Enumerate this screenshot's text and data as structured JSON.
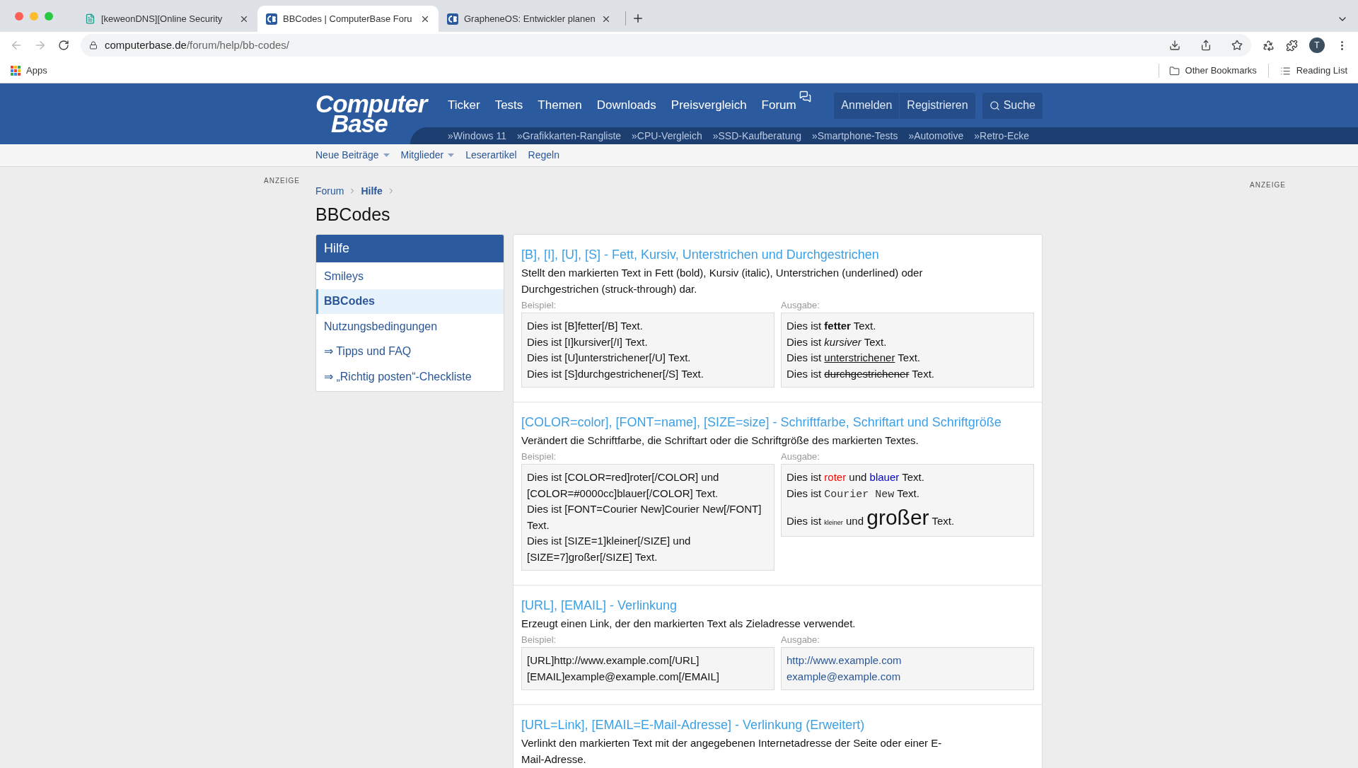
{
  "browser": {
    "tabs": [
      {
        "title": "[keweonDNS][Online Security",
        "selected": false,
        "kind": "document"
      },
      {
        "title": "BBCodes | ComputerBase Foru",
        "selected": true,
        "kind": "site"
      },
      {
        "title": "GrapheneOS: Entwickler planen",
        "selected": false,
        "kind": "site"
      }
    ],
    "address": {
      "host": "computerbase.de",
      "path": "/forum/help/bb-codes/"
    },
    "profile": "T",
    "bookmarks": [
      "Apps"
    ],
    "bookmarks_right": [
      "Other Bookmarks",
      "Reading List"
    ]
  },
  "header": {
    "logo": {
      "line1": "Computer",
      "line2": "Base"
    },
    "nav": [
      "Ticker",
      "Tests",
      "Themen",
      "Downloads",
      "Preisvergleich",
      "Forum"
    ],
    "account_buttons": [
      "Anmelden",
      "Registrieren"
    ],
    "search_button": "Suche",
    "quick_links": [
      "»Windows 11",
      "»Grafikkarten-Rangliste",
      "»CPU-Vergleich",
      "»SSD-Kaufberatung",
      "»Smartphone-Tests",
      "»Automotive",
      "»Retro-Ecke"
    ]
  },
  "subnav": [
    {
      "label": "Neue Beiträge",
      "dropdown": true
    },
    {
      "label": "Mitglieder",
      "dropdown": true
    },
    {
      "label": "Leserartikel",
      "dropdown": false
    },
    {
      "label": "Regeln",
      "dropdown": false
    }
  ],
  "ads": [
    "ANZEIGE",
    "ANZEIGE"
  ],
  "breadcrumb": [
    {
      "label": "Forum",
      "current": false
    },
    {
      "label": "Hilfe",
      "current": true
    }
  ],
  "page_title": "BBCodes",
  "sidebar": {
    "title": "Hilfe",
    "items": [
      {
        "label": "Smileys",
        "selected": false
      },
      {
        "label": "BBCodes",
        "selected": true
      },
      {
        "label": "Nutzungsbedingungen",
        "selected": false
      },
      {
        "label": "⇒ Tipps und FAQ",
        "selected": false
      },
      {
        "label": "⇒ „Richtig posten“-Checkliste",
        "selected": false
      }
    ]
  },
  "sections": [
    {
      "title": "[B], [I], [U], [S] - Fett, Kursiv, Unterstrichen und Durchgestrichen",
      "description": "Stellt den markierten Text in Fett (bold), Kursiv (italic), Unterstrichen (underlined) oder Durchgestrichen (struck-through) dar.",
      "example_label": "Beispiel:",
      "output_label": "Ausgabe:",
      "example_lines": [
        "Dies ist [B]fetter[/B] Text.",
        "Dies ist [I]kursiver[/I] Text.",
        "Dies ist [U]unterstrichener[/U] Text.",
        "Dies ist [S]durchgestrichener[/S] Text."
      ],
      "output_lines": [
        [
          {
            "text": "Dies ist "
          },
          {
            "text": "fetter",
            "kind": "bold"
          },
          {
            "text": " Text."
          }
        ],
        [
          {
            "text": "Dies ist "
          },
          {
            "text": "kursiver",
            "kind": "italic"
          },
          {
            "text": " Text."
          }
        ],
        [
          {
            "text": "Dies ist "
          },
          {
            "text": "unterstrichener",
            "kind": "underline"
          },
          {
            "text": " Text."
          }
        ],
        [
          {
            "text": "Dies ist "
          },
          {
            "text": "durchgestrichener",
            "kind": "strike"
          },
          {
            "text": " Text."
          }
        ]
      ]
    },
    {
      "title": "[COLOR=color], [FONT=name], [SIZE=size] - Schriftfarbe, Schriftart und Schriftgröße",
      "description": "Verändert die Schriftfarbe, die Schriftart oder die Schriftgröße des markierten Textes.",
      "example_label": "Beispiel:",
      "output_label": "Ausgabe:",
      "example_lines": [
        "Dies ist [COLOR=red]roter[/COLOR] und [COLOR=#0000cc]blauer[/COLOR] Text.",
        "Dies ist [FONT=Courier New]Courier New[/FONT] Text.",
        "Dies ist [SIZE=1]kleiner[/SIZE] und [SIZE=7]großer[/SIZE] Text."
      ],
      "output_lines": [
        [
          {
            "text": "Dies ist "
          },
          {
            "text": "roter",
            "kind": "red"
          },
          {
            "text": " und "
          },
          {
            "text": "blauer",
            "kind": "blue"
          },
          {
            "text": " Text."
          }
        ],
        [
          {
            "text": "Dies ist "
          },
          {
            "text": "Courier New",
            "kind": "mono"
          },
          {
            "text": " Text."
          }
        ],
        [
          {
            "text": "Dies ist "
          },
          {
            "text": "kleiner",
            "kind": "small"
          },
          {
            "text": " und "
          },
          {
            "text": "großer",
            "kind": "large"
          },
          {
            "text": " Text."
          }
        ]
      ]
    },
    {
      "title": "[URL], [EMAIL] - Verlinkung",
      "description": "Erzeugt einen Link, der den markierten Text als Zieladresse verwendet.",
      "example_label": "Beispiel:",
      "output_label": "Ausgabe:",
      "example_lines": [
        "[URL]http://www.example.com[/URL]",
        "[EMAIL]example@example.com[/EMAIL]"
      ],
      "output_lines": [
        [
          {
            "text": "http://www.example.com",
            "kind": "link"
          }
        ],
        [
          {
            "text": "example@example.com",
            "kind": "link"
          }
        ]
      ]
    },
    {
      "title": "[URL=Link], [EMAIL=E-Mail-Adresse] - Verlinkung (Erweitert)",
      "description": "Verlinkt den markierten Text mit der angegebenen Internetadresse der Seite oder einer E-Mail-Adresse."
    }
  ]
}
